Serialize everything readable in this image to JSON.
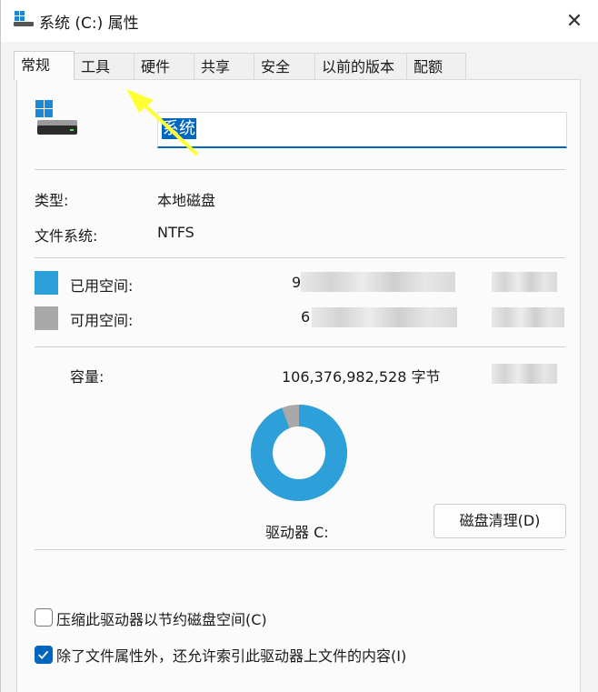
{
  "window": {
    "title": "系统 (C:) 属性",
    "close_glyph": "✕"
  },
  "tabs": [
    {
      "label": "常规",
      "active": true
    },
    {
      "label": "工具",
      "active": false
    },
    {
      "label": "硬件",
      "active": false
    },
    {
      "label": "共享",
      "active": false
    },
    {
      "label": "安全",
      "active": false
    },
    {
      "label": "以前的版本",
      "active": false
    },
    {
      "label": "配额",
      "active": false
    }
  ],
  "drive": {
    "name_value": "系统",
    "type_label": "类型:",
    "type_value": "本地磁盘",
    "fs_label": "文件系统:",
    "fs_value": "NTFS"
  },
  "space": {
    "used_label": "已用空间:",
    "used_value_visible": "9",
    "used_color": "#2d9fd9",
    "free_label": "可用空间:",
    "free_value_visible": "6",
    "free_color": "#a8a8a8",
    "capacity_label": "容量:",
    "capacity_value": "106,376,982,528 字节",
    "used_fraction": 0.94
  },
  "drive_label": "驱动器 C:",
  "cleanup_button": "磁盘清理(D)",
  "options": {
    "compress_label": "压缩此驱动器以节约磁盘空间(C)",
    "compress_checked": false,
    "index_label": "除了文件属性外，还允许索引此驱动器上文件的内容(I)",
    "index_checked": true
  },
  "colors": {
    "accent": "#0067c0",
    "annotation_arrow": "#ffff33"
  }
}
